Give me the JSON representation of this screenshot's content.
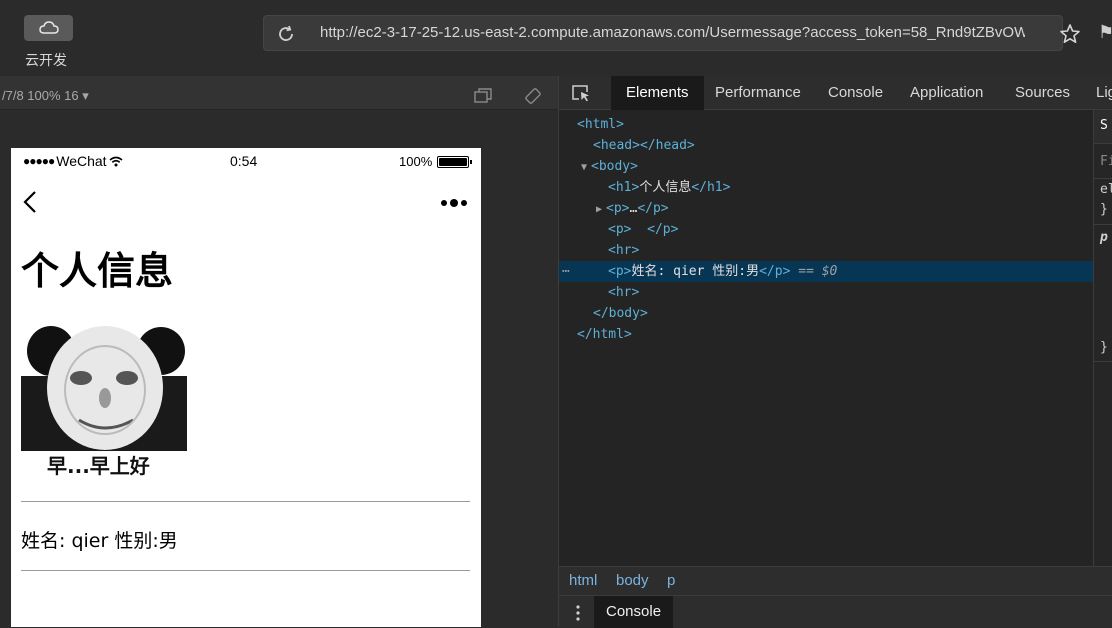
{
  "toolbar": {
    "cloud_label": "云开发",
    "url": "http://ec2-3-17-25-12.us-east-2.compute.amazonaws.com/Usermessage?access_token=58_Rnd9tZBvOW",
    "flag_glyph": "⚑"
  },
  "simulator": {
    "device_label": "/7/8 100% 16 ▾"
  },
  "phone": {
    "status": {
      "dots": "●●●●●",
      "carrier": "WeChat",
      "time": "0:54",
      "battery": "100%",
      "battery_level": 1.0
    },
    "page": {
      "heading": "个人信息",
      "meme_caption": "早...早上好",
      "info": "姓名: qier 性别:男"
    }
  },
  "devtools": {
    "tabs": [
      "Elements",
      "Performance",
      "Console",
      "Application",
      "Sources",
      "Lig"
    ],
    "active_tab": "Elements",
    "dom": {
      "html_open": "<html>",
      "head": "<head></head>",
      "body_open": "<body>",
      "h1_open": "<h1>",
      "h1_text": "个人信息",
      "h1_close": "</h1>",
      "p1_open": "<p>",
      "p1_text": "…",
      "p1_close": "</p>",
      "p2": "<p>  </p>",
      "hr": "<hr>",
      "p3_open": "<p>",
      "p3_text": "姓名: qier 性别:男",
      "p3_close": "</p>",
      "p3_ref": "== $0",
      "body_close": "</body>",
      "html_close": "</html>",
      "gutter_dots": "⋯"
    },
    "side_panel": {
      "tab": "S",
      "filter": "Fi",
      "row1": "el",
      "row2": "}",
      "row3": "p",
      "row4": "}"
    },
    "breadcrumbs": [
      "html",
      "body",
      "p"
    ],
    "drawer_tab": "Console"
  }
}
